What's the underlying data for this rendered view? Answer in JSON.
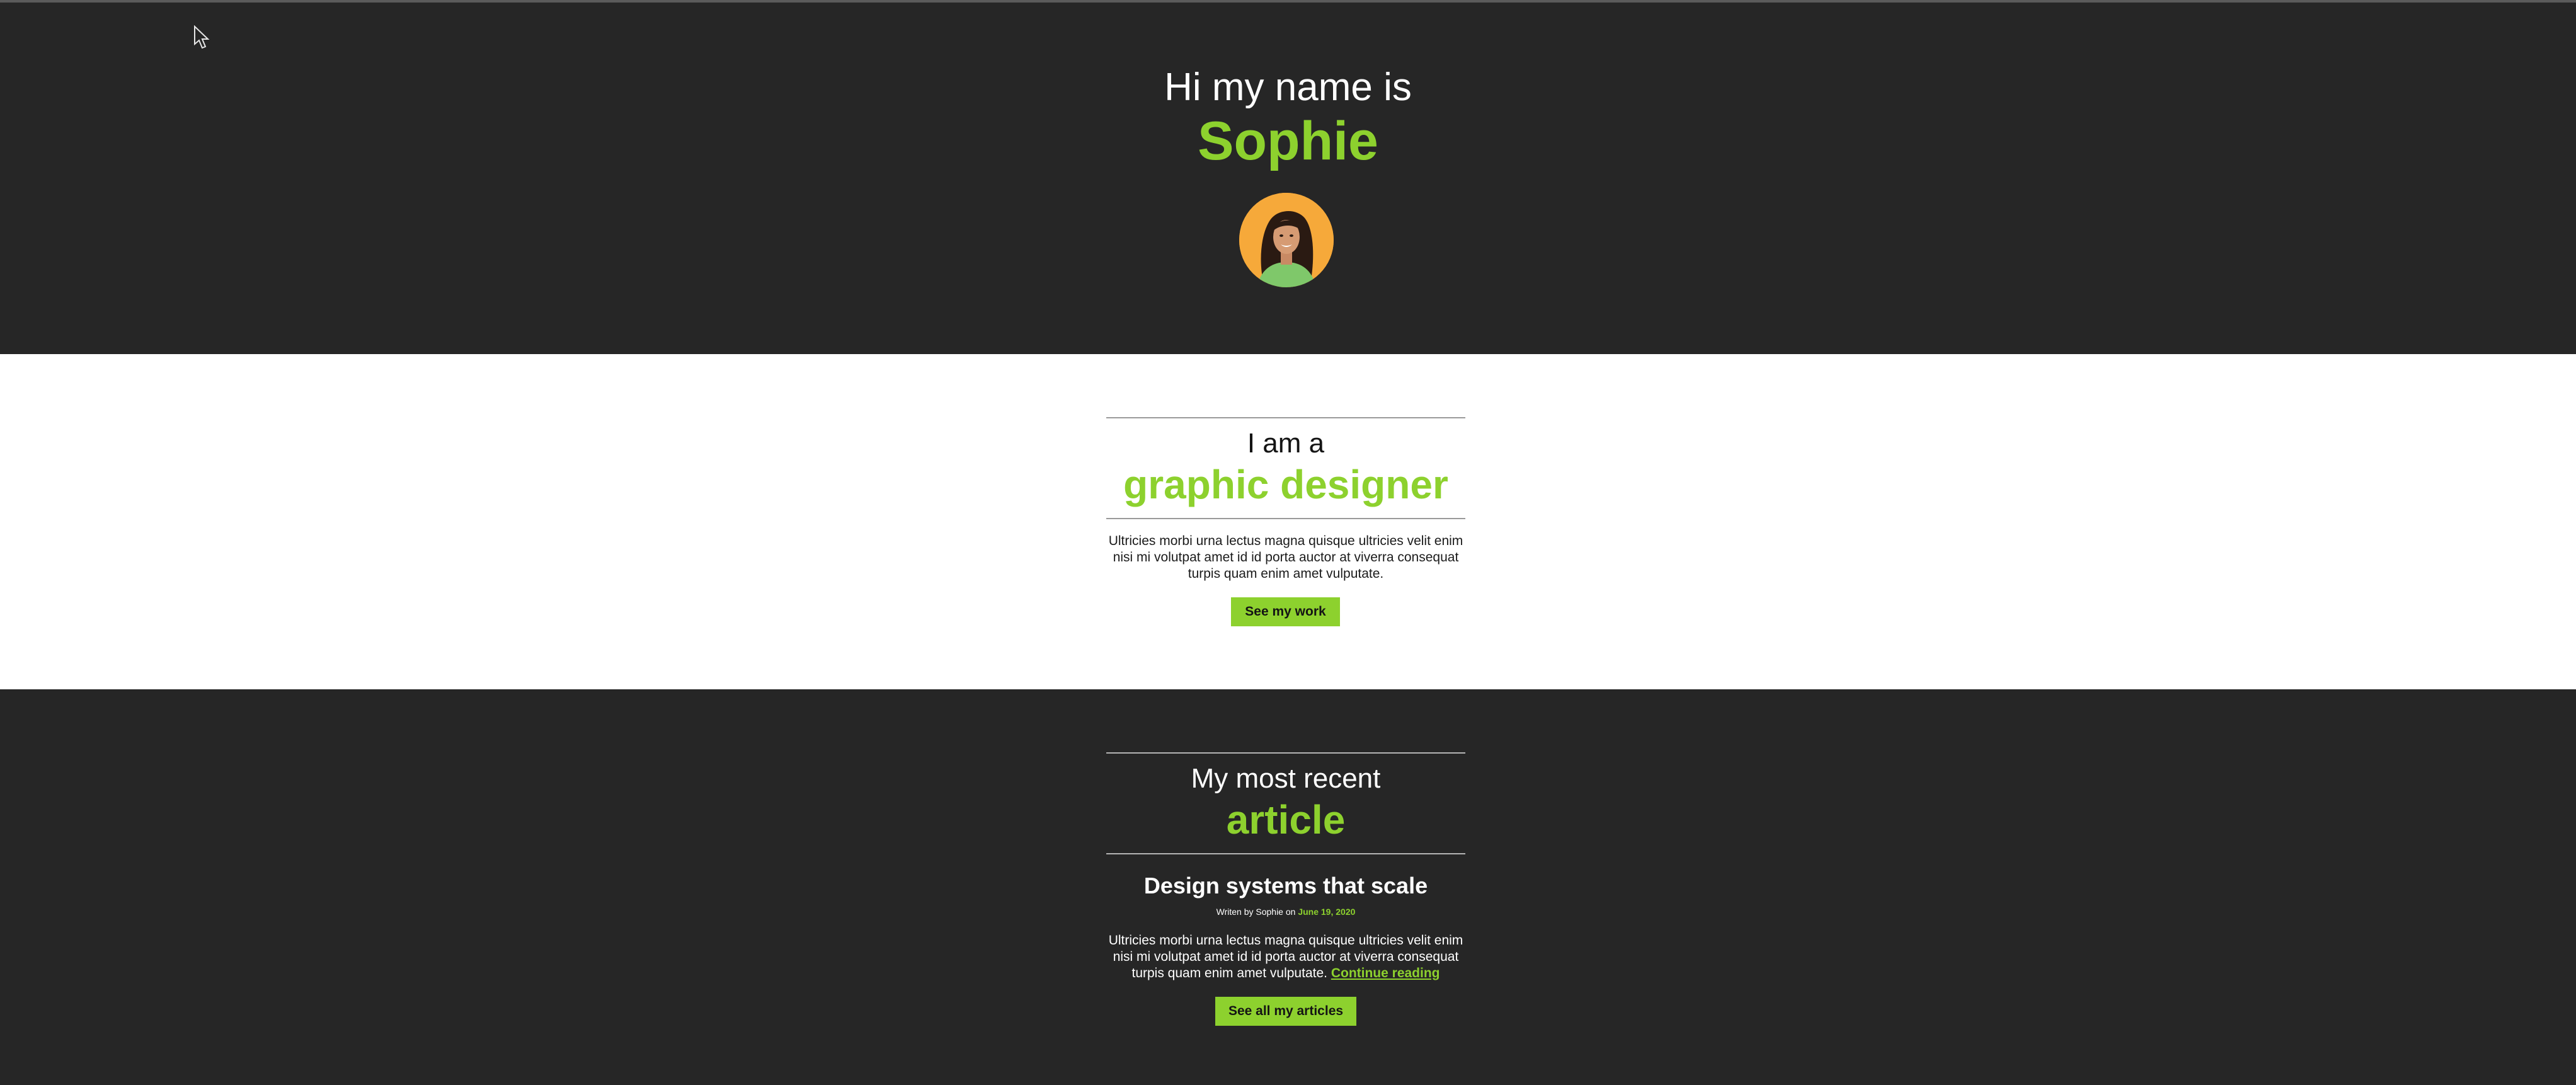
{
  "hero": {
    "greeting": "Hi my name is",
    "name": "Sophie"
  },
  "about": {
    "kicker": "I am a",
    "headline": "graphic designer",
    "body": "Ultricies morbi urna lectus magna quisque ultricies velit enim nisi mi volutpat amet id id porta auctor at viverra consequat turpis quam enim amet vulputate.",
    "button_label": "See my work"
  },
  "recent_article": {
    "kicker": "My most recent",
    "headline": "article",
    "post": {
      "title": "Design systems that scale",
      "byline_prefix": "Writen by Sophie on",
      "date": "June 19, 2020",
      "excerpt": "Ultricies morbi urna lectus magna quisque ultricies velit enim nisi mi volutpat amet id id porta auctor at viverra consequat turpis quam enim amet vulputate.",
      "continue_label": "Continue reading"
    },
    "button_label": "See all my articles"
  },
  "colors": {
    "accent": "#8dd12e",
    "dark_background": "#262626",
    "light_background": "#ffffff",
    "avatar_background": "#f6a93a"
  },
  "icons": {
    "pointer": "mouse-pointer-icon",
    "avatar": "profile-photo"
  }
}
